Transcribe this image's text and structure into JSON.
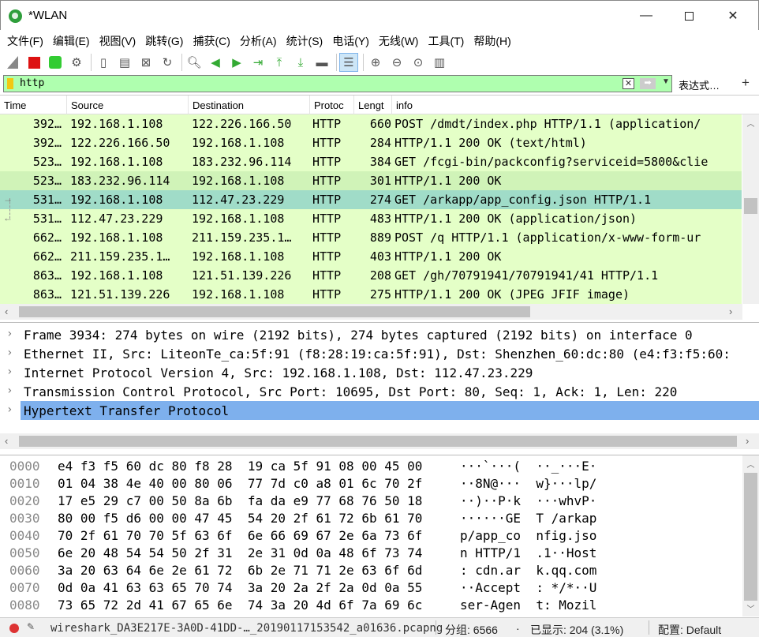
{
  "window": {
    "title": "*WLAN"
  },
  "menu": [
    "文件(F)",
    "编辑(E)",
    "视图(V)",
    "跳转(G)",
    "捕获(C)",
    "分析(A)",
    "统计(S)",
    "电话(Y)",
    "无线(W)",
    "工具(T)",
    "帮助(H)"
  ],
  "toolbar": {
    "icons": [
      "shark-fin-start-icon",
      "stop-capture-icon",
      "restart-capture-icon",
      "capture-options-icon",
      "open-file-icon",
      "save-file-icon",
      "close-file-icon",
      "reload-file-icon",
      "find-packet-icon",
      "go-back-icon",
      "go-forward-icon",
      "go-to-packet-icon",
      "go-first-icon",
      "go-last-icon",
      "auto-scroll-icon",
      "colorize-icon",
      "zoom-in-icon",
      "zoom-out-icon",
      "zoom-normal-icon",
      "resize-columns-icon"
    ]
  },
  "filter": {
    "value": "http",
    "expression_label": "表达式…",
    "plus": "+"
  },
  "packet_list": {
    "columns": [
      "Time",
      "Source",
      "Destination",
      "Protoc",
      "Lengt",
      "info"
    ],
    "rows": [
      {
        "no": "392…",
        "src": "192.168.1.108",
        "dst": "122.226.166.50",
        "proto": "HTTP",
        "len": "660",
        "info": "POST /dmdt/index.php HTTP/1.1  (application/"
      },
      {
        "no": "392…",
        "src": "122.226.166.50",
        "dst": "192.168.1.108",
        "proto": "HTTP",
        "len": "284",
        "info": "HTTP/1.1 200 OK  (text/html)"
      },
      {
        "no": "523…",
        "src": "192.168.1.108",
        "dst": "183.232.96.114",
        "proto": "HTTP",
        "len": "384",
        "info": "GET /fcgi-bin/packconfig?serviceid=5800&clie"
      },
      {
        "no": "523…",
        "src": "183.232.96.114",
        "dst": "192.168.1.108",
        "proto": "HTTP",
        "len": "301",
        "info": "HTTP/1.1 200 OK"
      },
      {
        "no": "531…",
        "src": "192.168.1.108",
        "dst": "112.47.23.229",
        "proto": "HTTP",
        "len": "274",
        "info": "GET /arkapp/app_config.json HTTP/1.1"
      },
      {
        "no": "531…",
        "src": "112.47.23.229",
        "dst": "192.168.1.108",
        "proto": "HTTP",
        "len": "483",
        "info": "HTTP/1.1 200 OK  (application/json)"
      },
      {
        "no": "662…",
        "src": "192.168.1.108",
        "dst": "211.159.235.1…",
        "proto": "HTTP",
        "len": "889",
        "info": "POST /q HTTP/1.1  (application/x-www-form-ur"
      },
      {
        "no": "662…",
        "src": "211.159.235.1…",
        "dst": "192.168.1.108",
        "proto": "HTTP",
        "len": "403",
        "info": "HTTP/1.1 200 OK"
      },
      {
        "no": "863…",
        "src": "192.168.1.108",
        "dst": "121.51.139.226",
        "proto": "HTTP",
        "len": "208",
        "info": "GET /gh/70791941/70791941/41 HTTP/1.1"
      },
      {
        "no": "863…",
        "src": "121.51.139.226",
        "dst": "192.168.1.108",
        "proto": "HTTP",
        "len": "275",
        "info": "HTTP/1.1 200 OK  (JPEG JFIF image)"
      }
    ]
  },
  "details": [
    "Frame 3934: 274 bytes on wire (2192 bits), 274 bytes captured (2192 bits) on interface 0",
    "Ethernet II, Src: LiteonTe_ca:5f:91 (f8:28:19:ca:5f:91), Dst: Shenzhen_60:dc:80 (e4:f3:f5:60:",
    "Internet Protocol Version 4, Src: 192.168.1.108, Dst: 112.47.23.229",
    "Transmission Control Protocol, Src Port: 10695, Dst Port: 80, Seq: 1, Ack: 1, Len: 220",
    "Hypertext Transfer Protocol"
  ],
  "bytes": [
    {
      "off": "0000",
      "hex": "e4 f3 f5 60 dc 80 f8 28  19 ca 5f 91 08 00 45 00",
      "asc": "···`···(  ··_···E·"
    },
    {
      "off": "0010",
      "hex": "01 04 38 4e 40 00 80 06  77 7d c0 a8 01 6c 70 2f",
      "asc": "··8N@···  w}···lp/"
    },
    {
      "off": "0020",
      "hex": "17 e5 29 c7 00 50 8a 6b  fa da e9 77 68 76 50 18",
      "asc": "··)··P·k  ···whvP·"
    },
    {
      "off": "0030",
      "hex": "80 00 f5 d6 00 00 47 45  54 20 2f 61 72 6b 61 70",
      "asc": "······GE  T /arkap"
    },
    {
      "off": "0040",
      "hex": "70 2f 61 70 70 5f 63 6f  6e 66 69 67 2e 6a 73 6f",
      "asc": "p/app_co  nfig.jso"
    },
    {
      "off": "0050",
      "hex": "6e 20 48 54 54 50 2f 31  2e 31 0d 0a 48 6f 73 74",
      "asc": "n HTTP/1  .1··Host"
    },
    {
      "off": "0060",
      "hex": "3a 20 63 64 6e 2e 61 72  6b 2e 71 71 2e 63 6f 6d",
      "asc": ": cdn.ar  k.qq.com"
    },
    {
      "off": "0070",
      "hex": "0d 0a 41 63 63 65 70 74  3a 20 2a 2f 2a 0d 0a 55",
      "asc": "··Accept  : */*··U"
    },
    {
      "off": "0080",
      "hex": "73 65 72 2d 41 67 65 6e  74 3a 20 4d 6f 7a 69 6c",
      "asc": "ser-Agen  t: Mozil"
    }
  ],
  "status": {
    "file": "wireshark_DA3E217E-3A0D-41DD-…_20190117153542_a01636.pcapng",
    "groups": "分组: 6566",
    "displayed": "已显示: 204 (3.1%)",
    "profile": "配置: Default"
  }
}
